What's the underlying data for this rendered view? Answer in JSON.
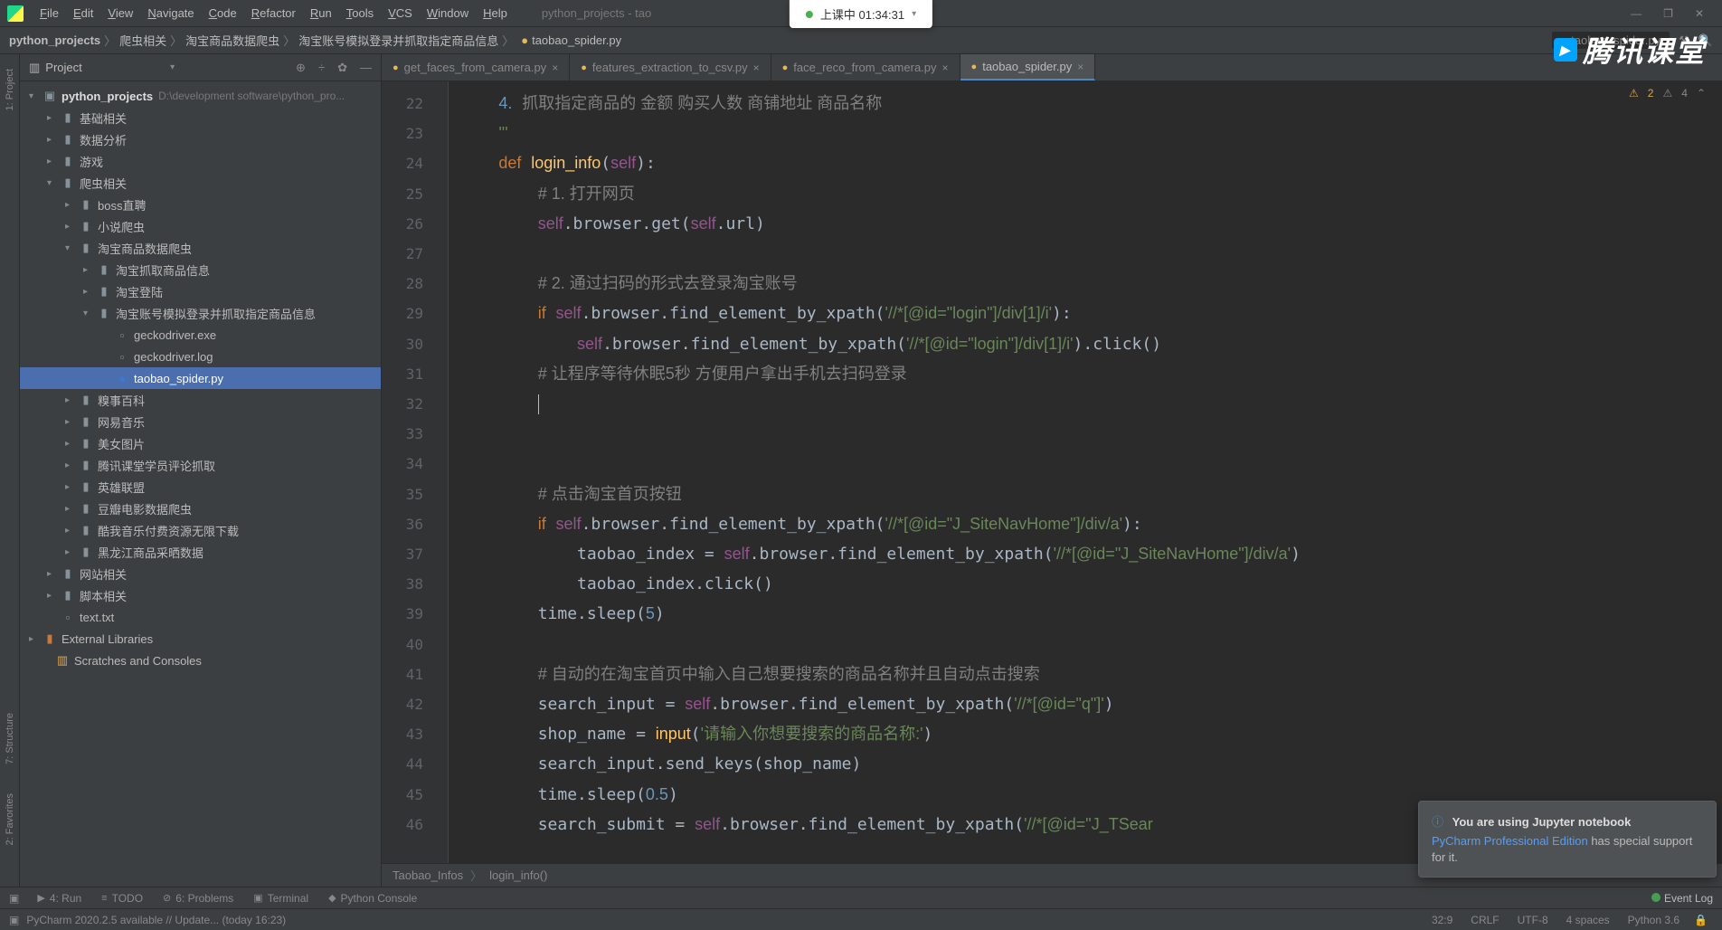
{
  "status_pill": {
    "text": "上课中 01:34:31"
  },
  "menu": {
    "items": [
      "File",
      "Edit",
      "View",
      "Navigate",
      "Code",
      "Refactor",
      "Run",
      "Tools",
      "VCS",
      "Window",
      "Help"
    ],
    "title": "python_projects - tao"
  },
  "window_controls": {
    "min": "—",
    "max": "❐",
    "close": "✕"
  },
  "breadcrumb": {
    "parts": [
      "python_projects",
      "爬虫相关",
      "淘宝商品数据爬虫",
      "淘宝账号模拟登录并抓取指定商品信息",
      "taobao_spider.py"
    ],
    "sep": "〉"
  },
  "brand_overlay": "腾讯课堂",
  "project": {
    "header": {
      "label": "Project",
      "tools": [
        "⊕",
        "÷",
        "✿",
        "—"
      ]
    },
    "root": {
      "name": "python_projects",
      "path": "D:\\development software\\python_pro..."
    },
    "tree": [
      {
        "indent": 1,
        "arrow": "closed",
        "icon": "folder",
        "label": "基础相关"
      },
      {
        "indent": 1,
        "arrow": "closed",
        "icon": "folder",
        "label": "数据分析"
      },
      {
        "indent": 1,
        "arrow": "closed",
        "icon": "folder",
        "label": "游戏"
      },
      {
        "indent": 1,
        "arrow": "open",
        "icon": "folder",
        "label": "爬虫相关"
      },
      {
        "indent": 2,
        "arrow": "closed",
        "icon": "folder",
        "label": "boss直聘"
      },
      {
        "indent": 2,
        "arrow": "closed",
        "icon": "folder",
        "label": "小说爬虫"
      },
      {
        "indent": 2,
        "arrow": "open",
        "icon": "folder",
        "label": "淘宝商品数据爬虫"
      },
      {
        "indent": 3,
        "arrow": "closed",
        "icon": "folder",
        "label": "淘宝抓取商品信息"
      },
      {
        "indent": 3,
        "arrow": "closed",
        "icon": "folder",
        "label": "淘宝登陆"
      },
      {
        "indent": 3,
        "arrow": "open",
        "icon": "folder",
        "label": "淘宝账号模拟登录并抓取指定商品信息"
      },
      {
        "indent": 4,
        "arrow": "none",
        "icon": "file",
        "label": "geckodriver.exe"
      },
      {
        "indent": 4,
        "arrow": "none",
        "icon": "file",
        "label": "geckodriver.log"
      },
      {
        "indent": 4,
        "arrow": "none",
        "icon": "py",
        "label": "taobao_spider.py",
        "selected": true
      },
      {
        "indent": 2,
        "arrow": "closed",
        "icon": "folder",
        "label": "糗事百科"
      },
      {
        "indent": 2,
        "arrow": "closed",
        "icon": "folder",
        "label": "网易音乐"
      },
      {
        "indent": 2,
        "arrow": "closed",
        "icon": "folder",
        "label": "美女图片"
      },
      {
        "indent": 2,
        "arrow": "closed",
        "icon": "folder",
        "label": "腾讯课堂学员评论抓取"
      },
      {
        "indent": 2,
        "arrow": "closed",
        "icon": "folder",
        "label": "英雄联盟"
      },
      {
        "indent": 2,
        "arrow": "closed",
        "icon": "folder",
        "label": "豆瓣电影数据爬虫"
      },
      {
        "indent": 2,
        "arrow": "closed",
        "icon": "folder",
        "label": "酷我音乐付费资源无限下载"
      },
      {
        "indent": 2,
        "arrow": "closed",
        "icon": "folder",
        "label": "黑龙江商品采晒数据"
      },
      {
        "indent": 1,
        "arrow": "closed",
        "icon": "folder",
        "label": "网站相关"
      },
      {
        "indent": 1,
        "arrow": "closed",
        "icon": "folder",
        "label": "脚本相关"
      },
      {
        "indent": 1,
        "arrow": "none",
        "icon": "file",
        "label": "text.txt"
      }
    ],
    "external": "External Libraries",
    "scratches": "Scratches and Consoles"
  },
  "left_tools": [
    "1: Project",
    "7: Structure",
    "2: Favorites"
  ],
  "editor": {
    "tabs": [
      {
        "label": "get_faces_from_camera.py",
        "active": false
      },
      {
        "label": "features_extraction_to_csv.py",
        "active": false
      },
      {
        "label": "face_reco_from_camera.py",
        "active": false
      },
      {
        "label": "taobao_spider.py",
        "active": true
      }
    ],
    "status": {
      "warn": "2",
      "weak": "4"
    },
    "line_start": 22,
    "line_end": 46,
    "code_lines": [
      "    <span class='num'>4.</span> <span class='cm'>抓取指定商品的 金额 购买人数 商铺地址 商品名称</span>",
      "    <span class='str'>'''</span>",
      "    <span class='kw'>def</span> <span class='fn'>login_info</span>(<span class='self'>self</span>):",
      "        <span class='cm'># 1. 打开网页</span>",
      "        <span class='self'>self</span>.browser.get(<span class='self'>self</span>.url)",
      "",
      "        <span class='cm'># 2. 通过扫码的形式去登录淘宝账号</span>",
      "        <span class='kw'>if</span> <span class='self'>self</span>.browser.find_element_by_xpath(<span class='str'>'//*[@id=\"login\"]/div[1]/i'</span>):",
      "            <span class='self'>self</span>.browser.find_element_by_xpath(<span class='str'>'//*[@id=\"login\"]/div[1]/i'</span>).click()",
      "        <span class='cm'># 让程序等待休眠5秒 方便用户拿出手机去扫码登录</span>",
      "        <span class='caret'></span>",
      "",
      "",
      "        <span class='cm'># 点击淘宝首页按钮</span>",
      "        <span class='kw'>if</span> <span class='self'>self</span>.browser.find_element_by_xpath(<span class='str'>'//*[@id=\"J_SiteNavHome\"]/div/a'</span>):",
      "            taobao_index = <span class='self'>self</span>.browser.find_element_by_xpath(<span class='str'>'//*[@id=\"J_SiteNavHome\"]/div/a'</span>)",
      "            taobao_index.click()",
      "        time.sleep(<span class='num'>5</span>)",
      "",
      "        <span class='cm'># 自动的在淘宝首页中输入自己想要搜索的商品名称并且自动点击搜索</span>",
      "        search_input = <span class='self'>self</span>.browser.find_element_by_xpath(<span class='str'>'//*[@id=\"q\"]'</span>)",
      "        shop_name = <span class='fn'>input</span>(<span class='str'>'请输入你想要搜索的商品名称:'</span>)",
      "        search_input.send_keys(shop_name)",
      "        time.sleep(<span class='num'>0.5</span>)",
      "        search_submit = <span class='self'>self</span>.browser.find_element_by_xpath(<span class='str'>'//*[@id=\"J_TSear</span>"
    ],
    "mini_breadcrumb": [
      "Taobao_Infos",
      "login_info()"
    ]
  },
  "notification": {
    "title": "You are using Jupyter notebook",
    "link": "PyCharm Professional Edition",
    "body_rest": " has special support for it."
  },
  "bottom_tools": [
    {
      "icon": "▶",
      "label": "4: Run"
    },
    {
      "icon": "≡",
      "label": "TODO"
    },
    {
      "icon": "⊘",
      "label": "6: Problems"
    },
    {
      "icon": "▣",
      "label": "Terminal"
    },
    {
      "icon": "◆",
      "label": "Python Console"
    }
  ],
  "event_log": "Event Log",
  "statusbar": {
    "msg": "PyCharm 2020.2.5 available // Update... (today 16:23)",
    "pos": "32:9",
    "eol": "CRLF",
    "enc": "UTF-8",
    "indent": "4 spaces",
    "python": "Python 3.6"
  }
}
